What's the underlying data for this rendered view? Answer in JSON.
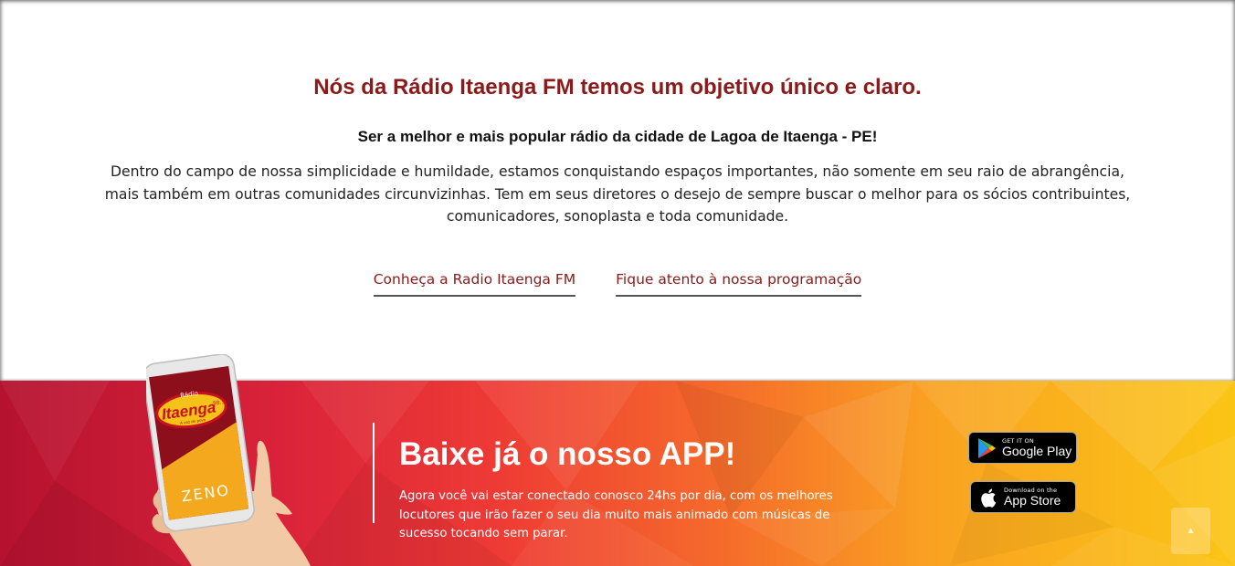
{
  "about": {
    "title": "Nós da Rádio Itaenga FM temos um objetivo único e claro.",
    "subtitle": "Ser a melhor e mais popular rádio da cidade de Lagoa de Itaenga - PE!",
    "text": "Dentro do campo de nossa simplicidade e humildade, estamos conquistando espaços importantes, não somente em seu raio de abrangência, mais também em outras comunidades circunvizinhas. Tem em seus diretores o desejo de sempre buscar o melhor para os sócios contribuintes, comunicadores, sonoplasta e toda comunidade.",
    "links": [
      {
        "label": "Conheça a Radio Itaenga FM"
      },
      {
        "label": "Fique atento à nossa programação"
      }
    ]
  },
  "app": {
    "title": "Baixe já o nosso APP!",
    "text": "Agora você vai estar conectado conosco 24hs por dia, com os melhores locutores que irão fazer o seu dia muito mais animado com músicas de sucesso tocando sem parar.",
    "phone": {
      "logo_small": "Rádio",
      "logo_main": "Itaenga",
      "logo_freq": "98.5",
      "logo_slogan": "A voz do povo",
      "zeno": "ZENO"
    },
    "google_play": {
      "small": "GET IT ON",
      "big": "Google Play"
    },
    "app_store": {
      "small": "Download on the",
      "big": "App Store"
    }
  },
  "colors": {
    "accent": "#8b1a1a",
    "band_start": "#b5122f",
    "band_end": "#fbc515"
  },
  "scroll_top": {
    "icon": "chevron-up-icon"
  }
}
